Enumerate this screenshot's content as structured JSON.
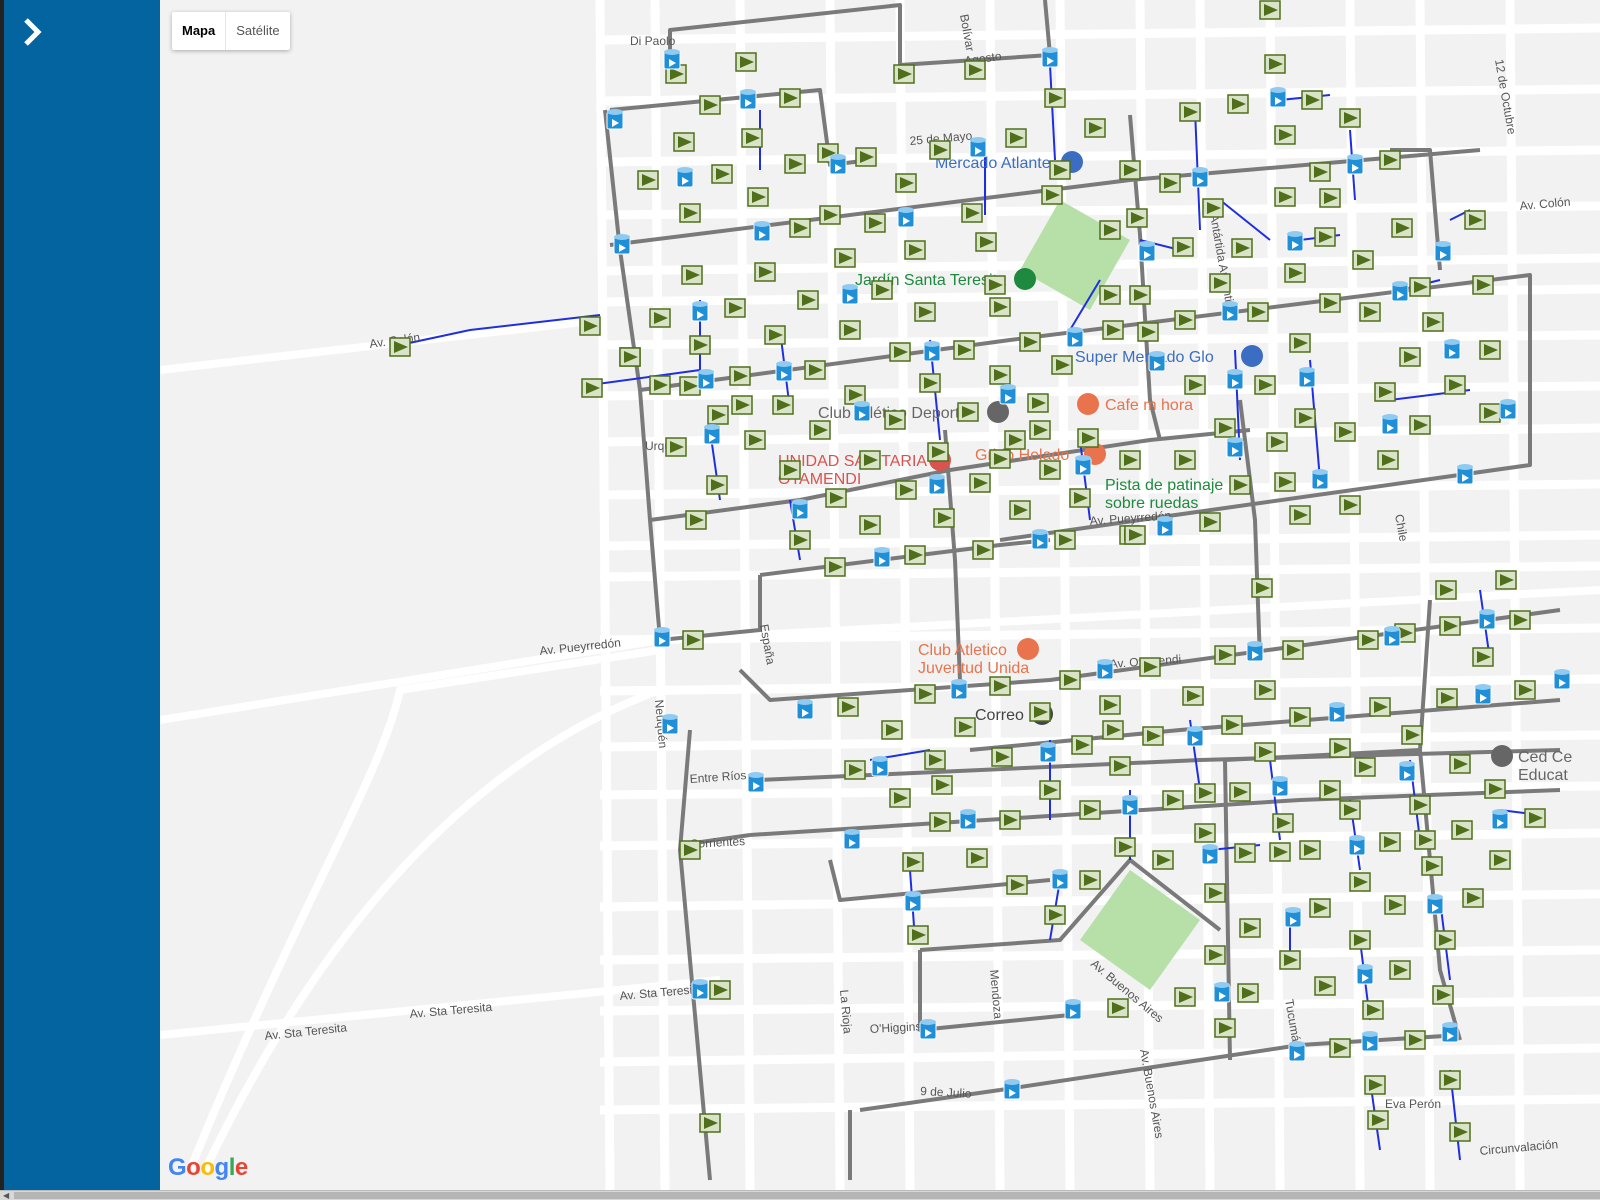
{
  "sidebar": {
    "expand_icon": "chevron-right-icon",
    "color": "#04649f"
  },
  "map_type": {
    "map_label": "Mapa",
    "satellite_label": "Satélite",
    "selected": "Mapa"
  },
  "google_logo": "Google",
  "colors": {
    "main_line": "#7a7a7a",
    "branch_line": "#1f2fe0",
    "valve_marker": "#4f6f1a",
    "tank_marker": "#1f8fd8",
    "park": "#b7e0a8"
  },
  "streets": [
    {
      "label": "Di Paolo"
    },
    {
      "label": "25 de Mayo"
    },
    {
      "label": "Av. Colón"
    },
    {
      "label": "Av. Colón"
    },
    {
      "label": "Av. Pueyrredón"
    },
    {
      "label": "Av. Pueyrredón"
    },
    {
      "label": "Av. Otamendi"
    },
    {
      "label": "Entre Ríos"
    },
    {
      "label": "Av. Sta Teresita"
    },
    {
      "label": "Av. Sta Teresita"
    },
    {
      "label": "Av. Sta Teresita"
    },
    {
      "label": "Av. Buenos Aires"
    },
    {
      "label": "Av. Buenos Aires"
    },
    {
      "label": "12 de Octubre"
    },
    {
      "label": "La Rioja"
    },
    {
      "label": "Mendoza"
    },
    {
      "label": "Chile"
    },
    {
      "label": "Eva Perón"
    },
    {
      "label": "9 de Julio"
    },
    {
      "label": "Antártida Argentina"
    },
    {
      "label": "Neuquén"
    },
    {
      "label": "Corrientes"
    },
    {
      "label": "España"
    },
    {
      "label": "Tucumán"
    },
    {
      "label": "O'Higgins"
    },
    {
      "label": "Bolívar"
    },
    {
      "label": "Circunvalación"
    },
    {
      "label": "Urquiza"
    },
    {
      "label": "Agosto"
    }
  ],
  "pois": [
    {
      "label": "Mercado Atlante",
      "kind": "shop-icon"
    },
    {
      "label": "Jardín Santa Teresita",
      "kind": "tree-icon"
    },
    {
      "label": "Super Mercado Glo",
      "kind": "shop-icon"
    },
    {
      "label": "Club Atlético Deport",
      "kind": "place-icon"
    },
    {
      "label": "Cafe m hora",
      "kind": "food-icon"
    },
    {
      "label": "UNIDAD SANITARIA OTAMENDI",
      "kind": "hospital-icon"
    },
    {
      "label": "Grido Helado",
      "kind": "food-icon"
    },
    {
      "label": "Pista de patinaje sobre ruedas",
      "kind": "place-icon"
    },
    {
      "label": "Club Atletico Juventud Unida",
      "kind": "food-icon"
    },
    {
      "label": "Correo",
      "kind": "post-icon"
    },
    {
      "label": "Ced Ce Educat",
      "kind": "school-icon"
    }
  ]
}
